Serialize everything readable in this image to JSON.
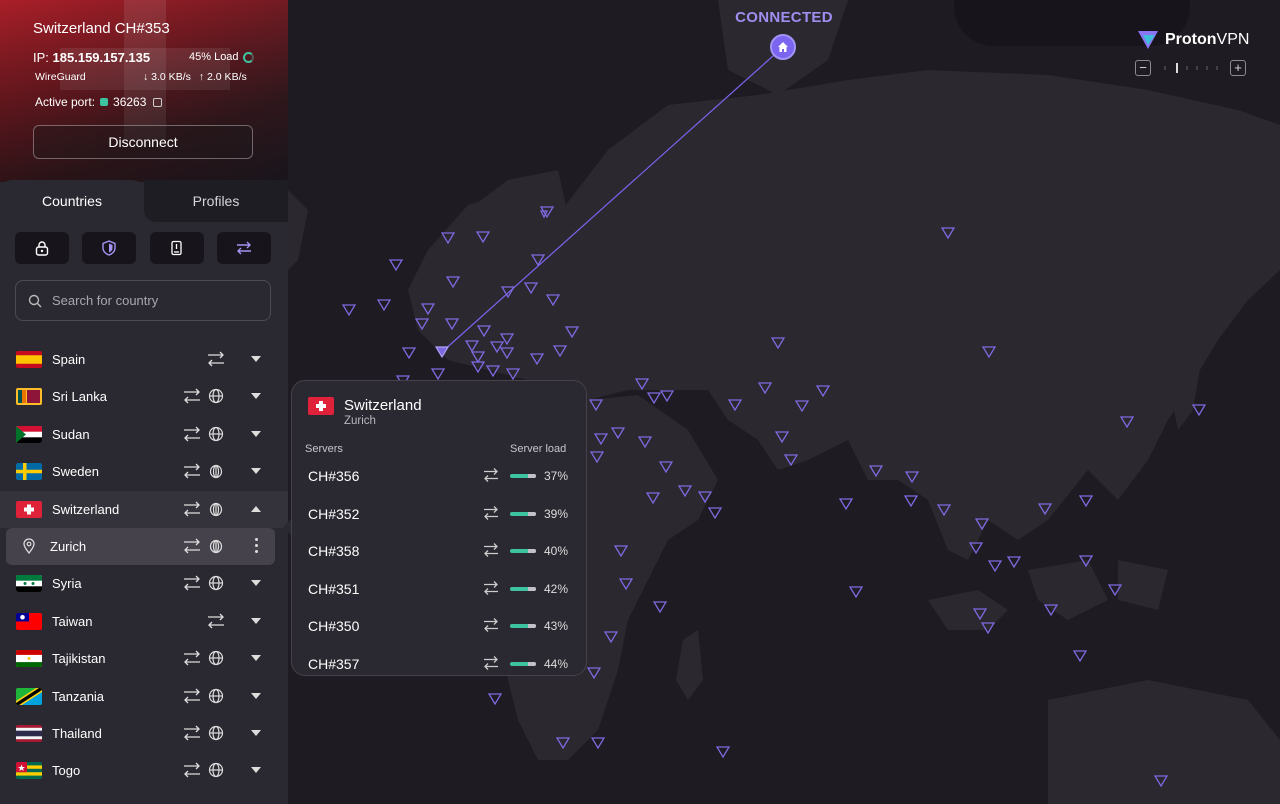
{
  "connection": {
    "server_title": "Switzerland CH#353",
    "ip_label": "IP:",
    "ip": "185.159.157.135",
    "load": "45% Load",
    "protocol": "WireGuard",
    "download": "3.0 KB/s",
    "upload": "2.0 KB/s",
    "port_label": "Active port:",
    "port": "36263",
    "disconnect_label": "Disconnect"
  },
  "tabs": {
    "countries": "Countries",
    "profiles": "Profiles"
  },
  "search": {
    "placeholder": "Search for country"
  },
  "countries": [
    {
      "name": "Spain"
    },
    {
      "name": "Sri Lanka"
    },
    {
      "name": "Sudan"
    },
    {
      "name": "Sweden"
    },
    {
      "name": "Switzerland"
    },
    {
      "name": "Zurich"
    },
    {
      "name": "Syria"
    },
    {
      "name": "Taiwan"
    },
    {
      "name": "Tajikistan"
    },
    {
      "name": "Tanzania"
    },
    {
      "name": "Thailand"
    },
    {
      "name": "Togo"
    }
  ],
  "map": {
    "status": "CONNECTED",
    "brand_proton": "Proton",
    "brand_vpn": "VPN",
    "accent": "#7b64ef"
  },
  "popup": {
    "country": "Switzerland",
    "city": "Zurich",
    "servers_header": "Servers",
    "load_header": "Server load",
    "servers": [
      {
        "name": "CH#356",
        "load": "37%"
      },
      {
        "name": "CH#352",
        "load": "39%"
      },
      {
        "name": "CH#358",
        "load": "40%"
      },
      {
        "name": "CH#351",
        "load": "42%"
      },
      {
        "name": "CH#350",
        "load": "43%"
      },
      {
        "name": "CH#357",
        "load": "44%"
      }
    ]
  }
}
